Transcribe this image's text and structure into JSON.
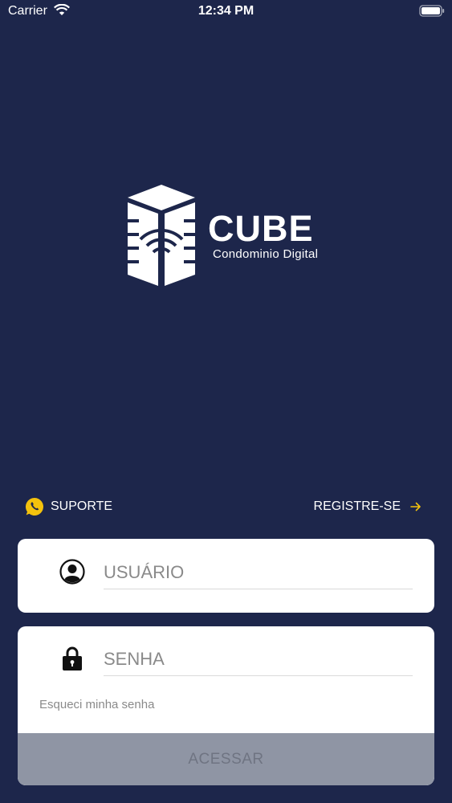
{
  "status_bar": {
    "carrier": "Carrier",
    "time": "12:34 PM"
  },
  "logo": {
    "word": "CUBE",
    "tagline": "Condominio Digital"
  },
  "links": {
    "support": "SUPORTE",
    "register": "REGISTRE-SE"
  },
  "form": {
    "username_placeholder": "USUÁRIO",
    "password_placeholder": "SENHA",
    "forgot_password": "Esqueci minha senha",
    "submit": "ACESSAR"
  },
  "colors": {
    "background": "#1d264b",
    "accent": "#f4c20d",
    "button_disabled": "#8f95a4"
  },
  "icons": [
    "wifi-icon",
    "battery-icon",
    "cube-building-icon",
    "whatsapp-icon",
    "arrow-right-icon",
    "user-icon",
    "lock-icon"
  ]
}
